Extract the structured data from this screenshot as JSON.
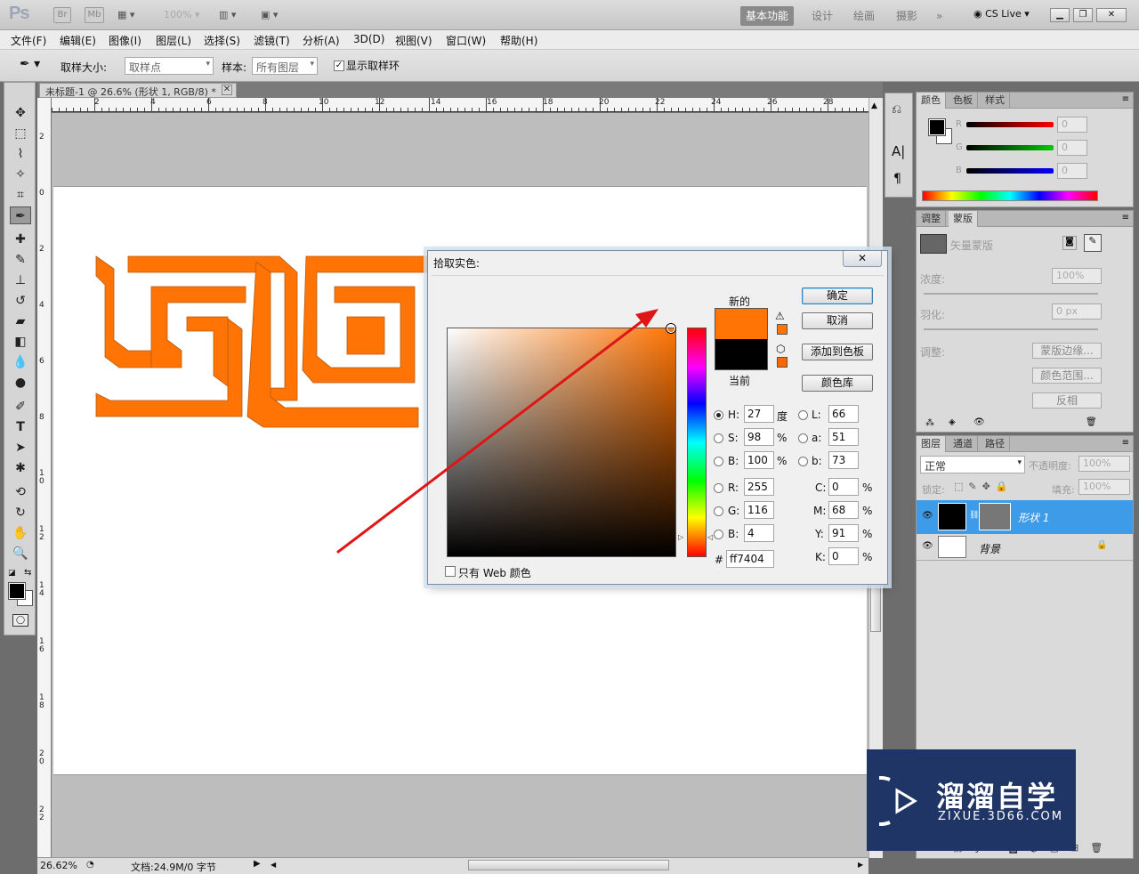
{
  "app": {
    "logo": "Ps",
    "icons": [
      "Br",
      "Mb"
    ],
    "zoom_dropdown": "100%",
    "workspaces": [
      "基本功能",
      "设计",
      "绘画",
      "摄影"
    ],
    "cs_live": "CS Live"
  },
  "menu": [
    "文件(F)",
    "编辑(E)",
    "图像(I)",
    "图层(L)",
    "选择(S)",
    "滤镜(T)",
    "分析(A)",
    "3D(D)",
    "视图(V)",
    "窗口(W)",
    "帮助(H)"
  ],
  "options": {
    "sample_size_label": "取样大小:",
    "sample_size_value": "取样点",
    "sample_label": "样本:",
    "sample_value": "所有图层",
    "show_ring_label": "显示取样环",
    "show_ring_checked": "✓"
  },
  "document": {
    "tab_title": "未标题-1 @ 26.6% (形状 1, RGB/8) *",
    "ruler_top": [
      "2",
      "4",
      "6",
      "8",
      "10",
      "12",
      "14",
      "16",
      "18",
      "20",
      "22",
      "24",
      "26",
      "28"
    ],
    "ruler_left": [
      "2",
      "0",
      "2",
      "4",
      "6",
      "8",
      "10",
      "12",
      "14",
      "16",
      "18",
      "20",
      "22"
    ],
    "shape_color": "#ff7404"
  },
  "status": {
    "zoom": "26.62%",
    "doc_info": "文档:24.9M/0 字节"
  },
  "dialog": {
    "title": "拾取实色:",
    "close": "✕",
    "new_label": "新的",
    "current_label": "当前",
    "new_color": "#ff7404",
    "current_color": "#000000",
    "btn_ok": "确定",
    "btn_cancel": "取消",
    "btn_add_swatch": "添加到色板",
    "btn_color_lib": "颜色库",
    "web_only_label": "只有 Web 颜色",
    "fields": {
      "H": {
        "label": "H:",
        "value": "27",
        "unit": "度"
      },
      "S": {
        "label": "S:",
        "value": "98",
        "unit": "%"
      },
      "B": {
        "label": "B:",
        "value": "100",
        "unit": "%"
      },
      "R": {
        "label": "R:",
        "value": "255"
      },
      "G": {
        "label": "G:",
        "value": "116"
      },
      "Bl": {
        "label": "B:",
        "value": "4"
      },
      "L": {
        "label": "L:",
        "value": "66"
      },
      "a": {
        "label": "a:",
        "value": "51"
      },
      "b": {
        "label": "b:",
        "value": "73"
      },
      "C": {
        "label": "C:",
        "value": "0",
        "unit": "%"
      },
      "M": {
        "label": "M:",
        "value": "68",
        "unit": "%"
      },
      "Y": {
        "label": "Y:",
        "value": "91",
        "unit": "%"
      },
      "K": {
        "label": "K:",
        "value": "0",
        "unit": "%"
      },
      "hex_label": "#",
      "hex": "ff7404"
    }
  },
  "color_panel": {
    "tabs": [
      "颜色",
      "色板",
      "样式"
    ],
    "r_label": "R",
    "g_label": "G",
    "b_label": "B",
    "r_value": "0",
    "g_value": "0",
    "b_value": "0"
  },
  "masks_panel": {
    "tabs": [
      "调整",
      "蒙版"
    ],
    "vector_mask": "矢量蒙版",
    "density_label": "浓度:",
    "density_value": "100%",
    "feather_label": "羽化:",
    "feather_value": "0 px",
    "refine_label": "调整:",
    "btn_mask_edge": "蒙版边缘...",
    "btn_color_range": "颜色范围...",
    "btn_invert": "反相"
  },
  "layers_panel": {
    "tabs": [
      "图层",
      "通道",
      "路径"
    ],
    "blend_mode": "正常",
    "opacity_label": "不透明度:",
    "opacity_value": "100%",
    "lock_label": "锁定:",
    "fill_label": "填充:",
    "fill_value": "100%",
    "layers": [
      {
        "name": "形状 1",
        "selected": true
      },
      {
        "name": "背景",
        "selected": false
      }
    ]
  },
  "watermark": {
    "title": "溜溜自学",
    "url": "ZIXUE.3D66.COM"
  }
}
